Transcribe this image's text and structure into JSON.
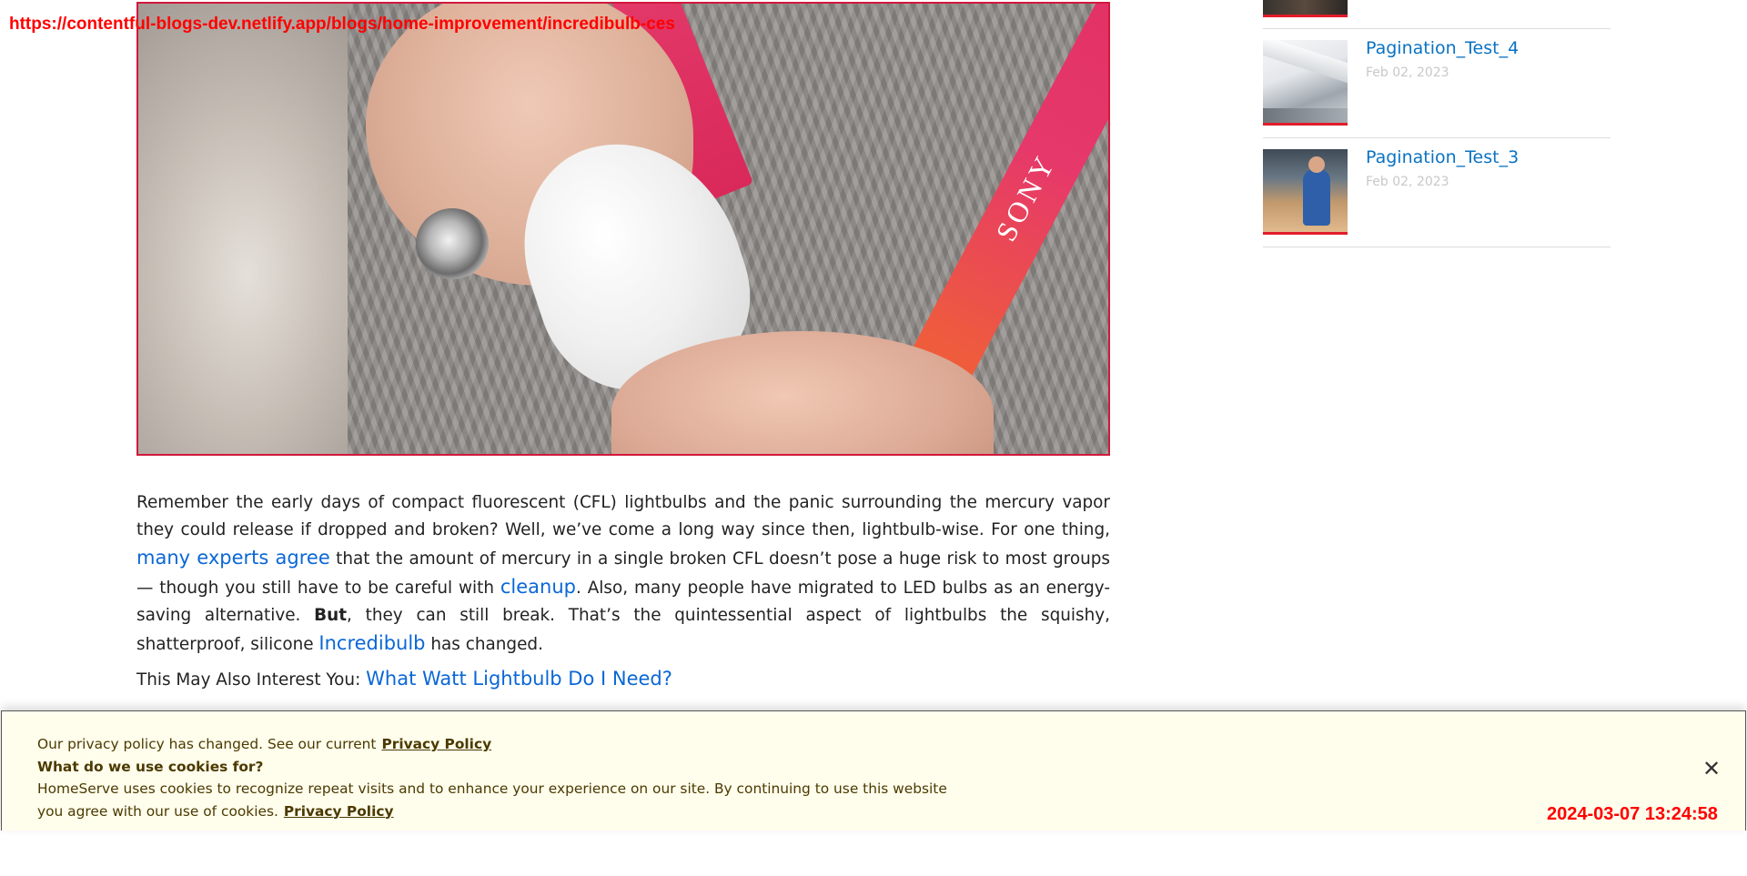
{
  "overlay": {
    "url": "https://contentful-blogs-dev.netlify.app/blogs/home-improvement/incredibulb-ces",
    "timestamp": "2024-03-07 13:24:58"
  },
  "hero": {
    "alt": "Hand squeezing a white silicone Incredibulb lightbulb in front of a person wearing a gray sweater and SONY lanyard",
    "lanyard_text": "SONY"
  },
  "article": {
    "p1_a": "Remember the early days of compact fluorescent (CFL) lightbulbs and the panic surrounding the mercury vapor they could release if dropped and broken? Well, we’ve come a long way since then, lightbulb-wise. For one thing, ",
    "link_experts": "many experts agree",
    "p1_b": " that the amount of mercury in a single broken CFL doesn’t pose a huge risk to most groups — though you still have to be careful with ",
    "link_cleanup": "cleanup",
    "p1_c": ". Also, many people have migrated to LED bulbs as an energy-saving alternative. ",
    "but": "But",
    "p1_d": ", they can still break. That’s the quintessential aspect of lightbulbs the squishy, shatterproof, silicone ",
    "link_incredibulb": "Incredibulb",
    "p1_e": " has changed.",
    "interest_label": "This May Also Interest You: ",
    "interest_link": "What Watt Lightbulb Do I Need?"
  },
  "sidebar": {
    "items": [
      {
        "title": "Pagination_Test_4",
        "date": "Feb 02, 2023"
      },
      {
        "title": "Pagination_Test_3",
        "date": "Feb 02, 2023"
      }
    ]
  },
  "cookie": {
    "line1": "Our privacy policy has changed. See our current",
    "policy_link_1": "Privacy Policy",
    "question": "What do we use cookies for?",
    "body": "HomeServe uses cookies to recognize repeat visits and to enhance your experience on our site. By continuing to use this website you agree with our use of cookies.",
    "policy_link_2": "Privacy Policy",
    "close_label": "✕"
  },
  "colors": {
    "link": "#0a67d6",
    "sidebar_title": "#0a73c2",
    "accent_red": "#e21c2a",
    "hero_border": "#d2183c",
    "cookie_bg": "#fffdec",
    "cookie_text": "#4b3a00"
  }
}
